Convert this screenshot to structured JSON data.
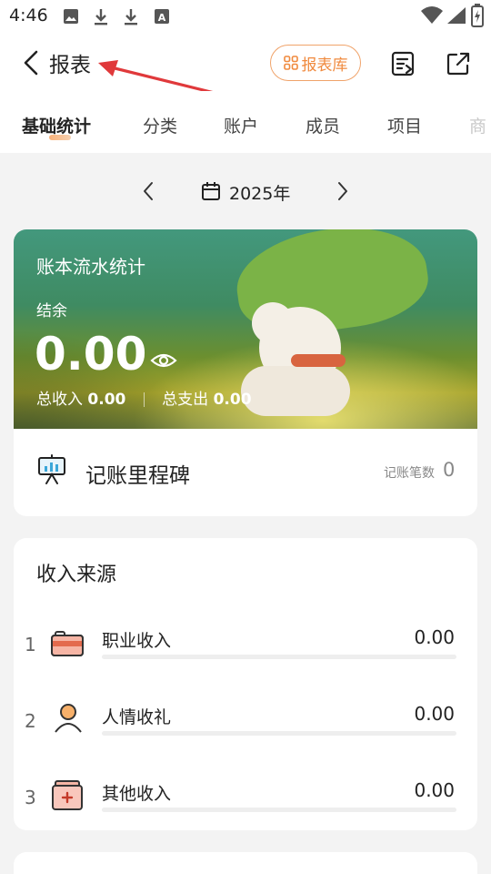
{
  "status_bar": {
    "time": "4:46",
    "icons": [
      "image-icon",
      "download-icon",
      "download-icon",
      "font-icon",
      "wifi-icon",
      "signal-icon",
      "battery-charging-icon"
    ]
  },
  "header": {
    "title": "报表",
    "library_button": "报表库",
    "icons": [
      "back-icon",
      "grid-icon",
      "export-list-icon",
      "share-icon"
    ]
  },
  "tabs": [
    {
      "label": "基础统计",
      "active": true
    },
    {
      "label": "分类",
      "active": false
    },
    {
      "label": "账户",
      "active": false
    },
    {
      "label": "成员",
      "active": false
    },
    {
      "label": "项目",
      "active": false
    },
    {
      "label": "商",
      "active": false
    }
  ],
  "date": {
    "label": "2025年"
  },
  "hero": {
    "title": "账本流水统计",
    "balance_label": "结余",
    "balance_value": "0.00",
    "total_income_label": "总收入",
    "total_income_value": "0.00",
    "total_expense_label": "总支出",
    "total_expense_value": "0.00"
  },
  "milestone": {
    "title": "记账里程碑",
    "count_label": "记账笔数",
    "count_value": "0"
  },
  "income_sources": {
    "title": "收入来源",
    "items": [
      {
        "index": "1",
        "name": "职业收入",
        "amount": "0.00",
        "icon": "briefcase-icon"
      },
      {
        "index": "2",
        "name": "人情收礼",
        "amount": "0.00",
        "icon": "person-icon"
      },
      {
        "index": "3",
        "name": "其他收入",
        "amount": "0.00",
        "icon": "wallet-plus-icon"
      }
    ]
  },
  "colors": {
    "accent": "#f08a3e",
    "page_bg": "#f3f3f3",
    "card_bg": "#ffffff",
    "annotation_arrow": "#e0393b"
  }
}
